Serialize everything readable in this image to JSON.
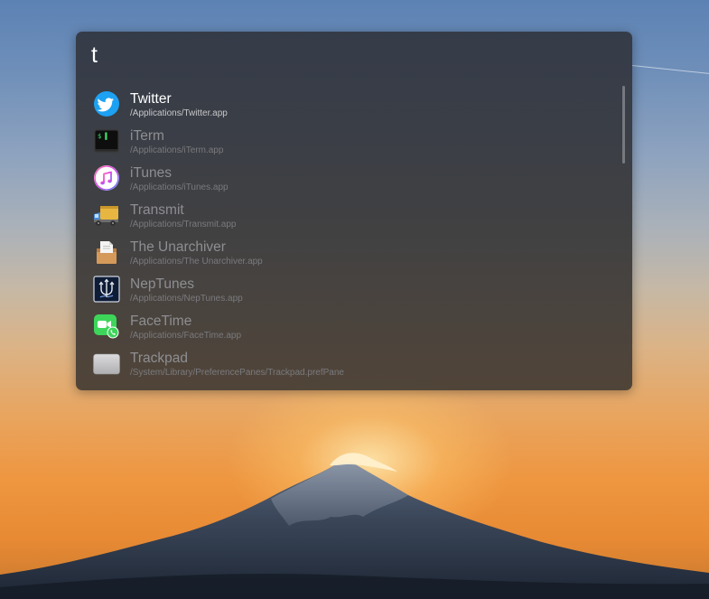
{
  "launcher": {
    "query": "t",
    "results": [
      {
        "title": "Twitter",
        "path": "/Applications/Twitter.app",
        "icon": "twitter-icon",
        "selected": true
      },
      {
        "title": "iTerm",
        "path": "/Applications/iTerm.app",
        "icon": "iterm-icon",
        "selected": false
      },
      {
        "title": "iTunes",
        "path": "/Applications/iTunes.app",
        "icon": "itunes-icon",
        "selected": false
      },
      {
        "title": "Transmit",
        "path": "/Applications/Transmit.app",
        "icon": "transmit-icon",
        "selected": false
      },
      {
        "title": "The Unarchiver",
        "path": "/Applications/The Unarchiver.app",
        "icon": "unarchiver-icon",
        "selected": false
      },
      {
        "title": "NepTunes",
        "path": "/Applications/NepTunes.app",
        "icon": "neptunes-icon",
        "selected": false
      },
      {
        "title": "FaceTime",
        "path": "/Applications/FaceTime.app",
        "icon": "facetime-icon",
        "selected": false
      },
      {
        "title": "Trackpad",
        "path": "/System/Library/PreferencePanes/Trackpad.prefPane",
        "icon": "trackpad-icon",
        "selected": false
      }
    ]
  },
  "iterm_prompt": "$ ▌",
  "colors": {
    "selected_text": "#ffffff",
    "dim_text": "#8e8e92",
    "twitter_blue": "#1da1f2",
    "facetime_green": "#3dd55a"
  }
}
